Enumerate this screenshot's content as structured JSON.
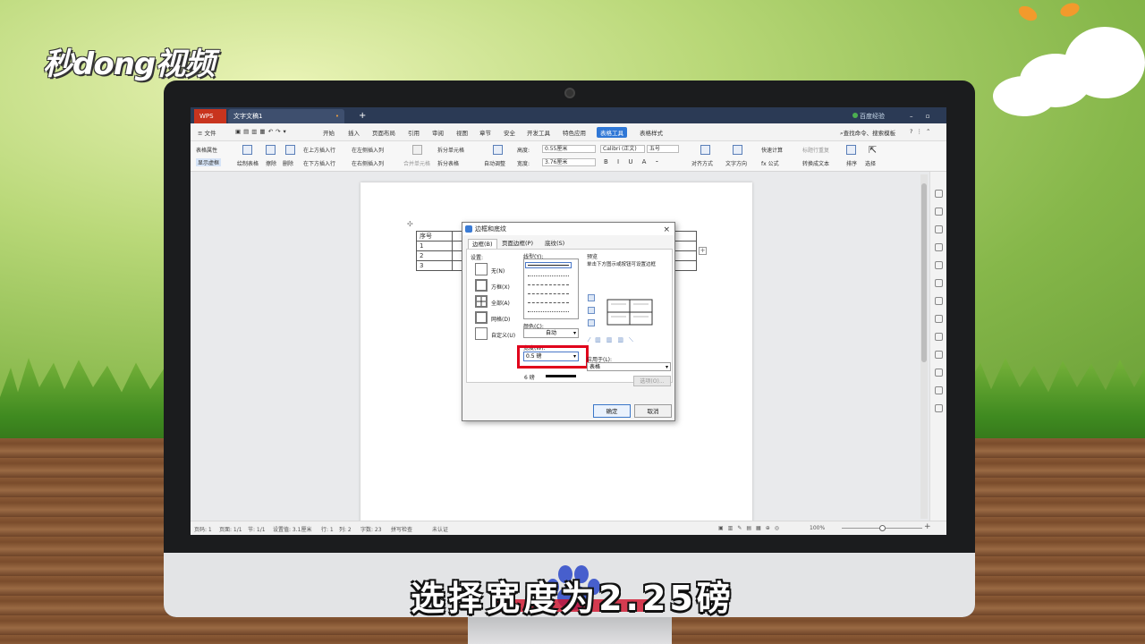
{
  "watermark": {
    "logo_text": "秒dong视频"
  },
  "app": {
    "brand": "WPS",
    "doc_tab": "文字文稿1",
    "new_tab": "+",
    "titlebar_right": "百度经验"
  },
  "menu": {
    "file": "≡ 文件",
    "items": [
      "开始",
      "插入",
      "页面布局",
      "引用",
      "审阅",
      "视图",
      "章节",
      "安全",
      "开发工具",
      "特色应用"
    ],
    "active": "表格工具",
    "table_style": "表格样式",
    "search": "查找命令、搜索模板"
  },
  "ribbon": {
    "table_props": "表格属性",
    "show_grid": "显示虚框",
    "draw_table": "绘制表格",
    "erase": "擦除",
    "delete": "删除",
    "insert_above": "在上方插入行",
    "insert_below": "在下方插入行",
    "insert_left": "在左侧插入列",
    "insert_right": "在右侧插入列",
    "merge_cells": "合并单元格",
    "split_cells": "拆分单元格",
    "split_table": "拆分表格",
    "auto_fit": "自动调整",
    "height_label": "高度:",
    "height_value": "0.55厘米",
    "width_label": "宽度:",
    "width_value": "3.76厘米",
    "font_name": "Calibri (正文)",
    "font_size": "五号",
    "align": "对齐方式",
    "text_dir": "文字方向",
    "quick_calc": "快速计算",
    "title_repeat": "标题行重复",
    "formula": "fx 公式",
    "convert_text": "转换成文本",
    "sort": "排序",
    "select": "选择"
  },
  "document": {
    "table_rows": [
      "序号",
      "1",
      "2",
      "3"
    ]
  },
  "dialog": {
    "title": "边框和底纹",
    "close": "×",
    "tabs": [
      "边框(B)",
      "页面边框(P)",
      "底纹(S)"
    ],
    "settings_label": "设置:",
    "settings": [
      "无(N)",
      "方框(X)",
      "全部(A)",
      "网格(D)",
      "自定义(U)"
    ],
    "style_label": "线型(Y):",
    "color_label": "颜色(C):",
    "color_value": "自动",
    "width_label": "宽度(W):",
    "width_value": "0.5 磅",
    "width_options": [
      "6 磅"
    ],
    "preview_label": "预览",
    "preview_hint": "单击下方图示或按钮可设置边框",
    "apply_label": "应用于(L):",
    "apply_value": "表格",
    "options_btn": "选项(O)...",
    "ok": "确定",
    "cancel": "取消"
  },
  "status": {
    "page": "页码: 1",
    "pages": "页面: 1/1",
    "section": "节: 1/1",
    "setting": "设置值: 3.1厘米",
    "row": "行: 1",
    "col": "列: 2",
    "words": "字数: 23",
    "spell": "拼写检查",
    "auth": "未认证",
    "zoom": "100%"
  },
  "caption": {
    "text": "选择宽度为2.25磅"
  },
  "colors": {
    "accent": "#2f77d6",
    "highlight": "#e0001b",
    "titlebar": "#2b3a55"
  }
}
